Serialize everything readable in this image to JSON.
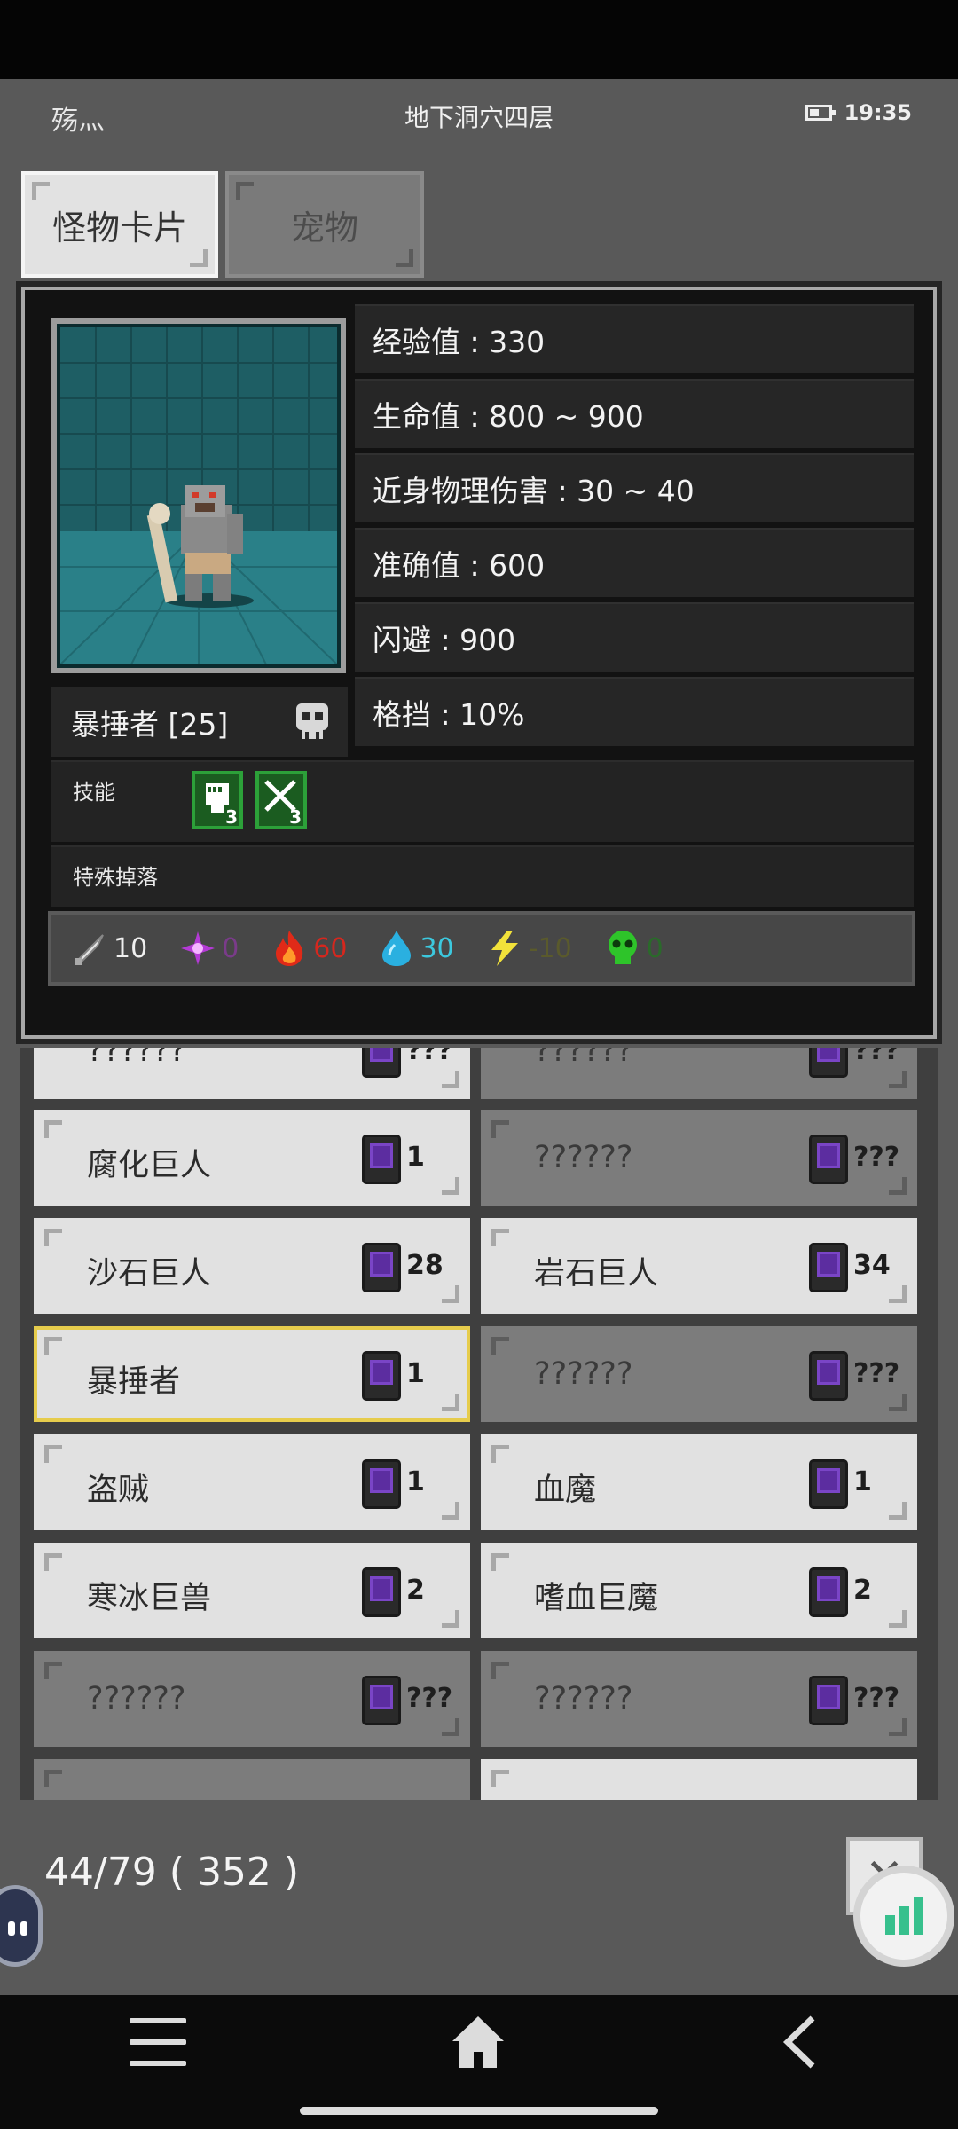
{
  "status": {
    "left_text": "殇灬",
    "location": "地下洞穴四层",
    "time": "19:35"
  },
  "tabs": [
    {
      "label": "怪物卡片",
      "active": true
    },
    {
      "label": "宠物",
      "active": false
    }
  ],
  "monster": {
    "name": "暴捶者 [25]",
    "stats": [
      {
        "label": "经验值 : 330"
      },
      {
        "label": "生命值 : 800 ~ 900"
      },
      {
        "label": "近身物理伤害 : 30 ~ 40"
      },
      {
        "label": "准确值 : 600"
      },
      {
        "label": "闪避 : 900"
      },
      {
        "label": "格挡 : 10%"
      }
    ],
    "skills_label": "技能",
    "skills": [
      {
        "icon": "fist-icon",
        "level": "3"
      },
      {
        "icon": "crossed-swords-icon",
        "level": "3"
      }
    ],
    "drop_label": "特殊掉落",
    "resistances": [
      {
        "icon": "physical-icon",
        "value": "10",
        "color": "#f0f0f0"
      },
      {
        "icon": "magic-icon",
        "value": "0",
        "color": "#7a3b8a"
      },
      {
        "icon": "fire-icon",
        "value": "60",
        "color": "#d6271e"
      },
      {
        "icon": "water-icon",
        "value": "30",
        "color": "#3cc8de"
      },
      {
        "icon": "lightning-icon",
        "value": "-10",
        "color": "#5a5a2c"
      },
      {
        "icon": "poison-icon",
        "value": "0",
        "color": "#2a6a2a"
      }
    ]
  },
  "cards": [
    {
      "name": "??????",
      "count": "???",
      "state": "known"
    },
    {
      "name": "??????",
      "count": "???",
      "state": "unknown"
    },
    {
      "name": "腐化巨人",
      "count": "1",
      "state": "known"
    },
    {
      "name": "??????",
      "count": "???",
      "state": "unknown"
    },
    {
      "name": "沙石巨人",
      "count": "28",
      "state": "known"
    },
    {
      "name": "岩石巨人",
      "count": "34",
      "state": "known"
    },
    {
      "name": "暴捶者",
      "count": "1",
      "state": "selected"
    },
    {
      "name": "??????",
      "count": "???",
      "state": "unknown"
    },
    {
      "name": "盗贼",
      "count": "1",
      "state": "known"
    },
    {
      "name": "血魔",
      "count": "1",
      "state": "known"
    },
    {
      "name": "寒冰巨兽",
      "count": "2",
      "state": "known"
    },
    {
      "name": "嗜血巨魔",
      "count": "2",
      "state": "known"
    },
    {
      "name": "??????",
      "count": "???",
      "state": "unknown"
    },
    {
      "name": "??????",
      "count": "???",
      "state": "unknown"
    },
    {
      "name": "",
      "count": "",
      "state": "known"
    },
    {
      "name": "",
      "count": "",
      "state": "known"
    }
  ],
  "footer": {
    "count_text": "44/79 ( 352 )"
  }
}
